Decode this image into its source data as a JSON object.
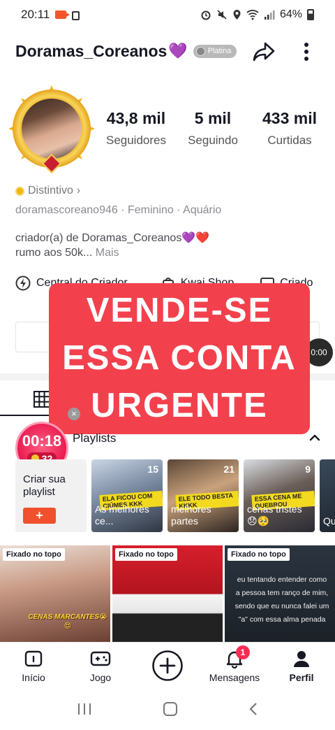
{
  "status_bar": {
    "time": "20:11",
    "battery": "64%"
  },
  "header": {
    "username": "Doramas_Coreanos",
    "username_emoji": "💜",
    "badge": "Platina",
    "share_icon": "share-arrow-icon",
    "more_icon": "vertical-dots-icon"
  },
  "stats": [
    {
      "value": "43,8 mil",
      "label": "Seguidores"
    },
    {
      "value": "5 mil",
      "label": "Seguindo"
    },
    {
      "value": "433 mil",
      "label": "Curtidas"
    }
  ],
  "profile": {
    "badge_label": "Distintivo",
    "badge_chevron": "›",
    "handle": "doramascoreano946",
    "gender": "Feminino",
    "sign": "Aquário",
    "bio_line1": "criador(a) de Doramas_Coreanos💜❤️",
    "bio_line2": "rumo aos 50k...",
    "bio_more": "Mais"
  },
  "links": {
    "item1": "Central do Criador",
    "item2": "Kwai Shop",
    "item3": "Criado"
  },
  "live_chip": "0:00",
  "overlay": {
    "line1": "VENDE-SE",
    "line2": "ESSA CONTA",
    "line3": "URGENTE"
  },
  "timer": {
    "time": "00:18",
    "coins": "32",
    "close": "×"
  },
  "playlists": {
    "title": "Playlists",
    "create_label": "Criar sua playlist",
    "create_button": "+",
    "items": [
      {
        "count": "15",
        "sticker": "ELA FICOU COM CIÚMES KKK",
        "name": "As melhores ce..."
      },
      {
        "count": "21",
        "sticker": "ELE TODO BESTA KKKK",
        "name": "melhores partes"
      },
      {
        "count": "9",
        "sticker": "ESSA CENA ME QUEBROU",
        "name": "cenas tristes 😞🥺"
      },
      {
        "count": "",
        "sticker": "",
        "name": "Qu"
      }
    ]
  },
  "videos": [
    {
      "pin": "Fixado no topo",
      "caption": "CENAS MARCANTES😭😍",
      "text": ""
    },
    {
      "pin": "Fixado no topo",
      "caption": "",
      "text": ""
    },
    {
      "pin": "Fixado no topo",
      "caption": "",
      "text": "eu tentando entender como a pessoa tem ranço de mim, sendo que eu nunca falei um \"a\" com essa alma penada"
    }
  ],
  "bottom_nav": {
    "inicio": "Início",
    "jogo": "Jogo",
    "mensagens": "Mensagens",
    "mensagens_badge": "1",
    "perfil": "Perfil"
  },
  "colors": {
    "accent": "#f0502d",
    "overlay": "#f2414d",
    "timer": "#e9184e",
    "badge_purple": "#9b3fe0"
  }
}
